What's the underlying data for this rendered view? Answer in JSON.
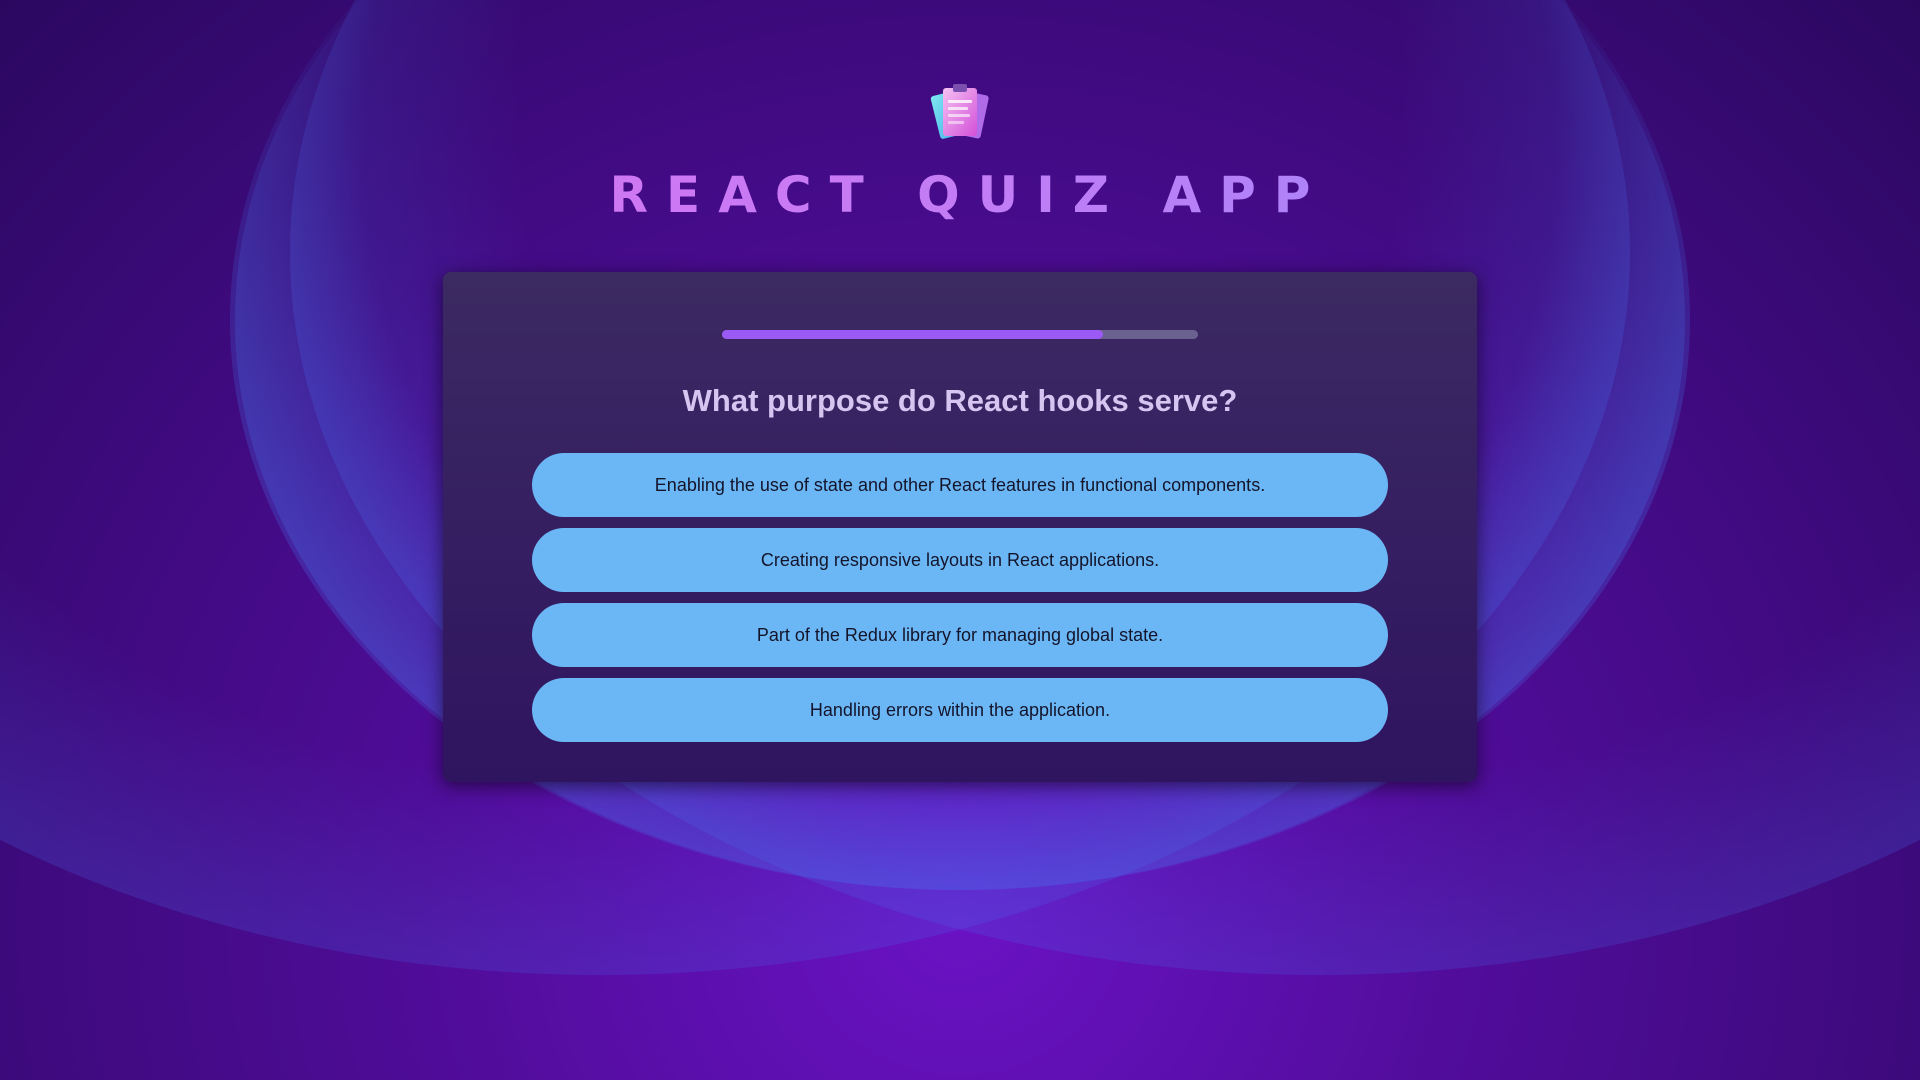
{
  "app": {
    "title": "REACT QUIZ APP",
    "logo_icon": "quiz-clipboard-icon"
  },
  "quiz": {
    "progress_fraction": 0.8,
    "question": "What purpose do React hooks serve?",
    "answers": [
      {
        "label": "Enabling the use of state and other React features in functional components."
      },
      {
        "label": "Creating responsive layouts in React applications."
      },
      {
        "label": "Part of the Redux library for managing global state."
      },
      {
        "label": "Handling errors within the application."
      }
    ]
  },
  "colors": {
    "progress_fill": "#9b59f5",
    "progress_track": "#6b6190",
    "answer_bg": "#6bb7f5",
    "card_bg": "#3c2a62"
  }
}
